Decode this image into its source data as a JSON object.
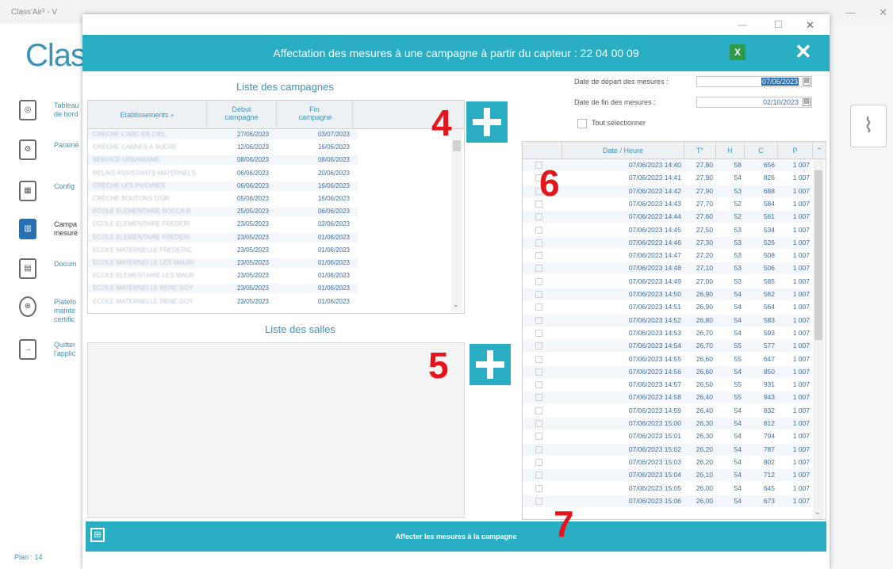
{
  "bg_window": {
    "title": "Class'Air² - V",
    "controls": [
      "—",
      "☐",
      "✕"
    ],
    "logo": "Class",
    "sidebar": [
      {
        "icon": "dashboard-icon",
        "label": "Tableau de bord"
      },
      {
        "icon": "settings-icon",
        "label": "Paramè"
      },
      {
        "icon": "building-icon",
        "label": "Config"
      },
      {
        "icon": "campaign-icon",
        "label": "Campa mesure"
      },
      {
        "icon": "document-icon",
        "label": "Docum"
      },
      {
        "icon": "globe-icon",
        "label": "Platefo mainte certific"
      },
      {
        "icon": "exit-icon",
        "label": "Quitter l'applic"
      }
    ],
    "plan": "Plan : 14"
  },
  "modal": {
    "controls": [
      "—",
      "☐",
      "✕"
    ],
    "title": "Affectation des mesures à une campagne à partir du capteur : 22 04 00 09",
    "close": "✕",
    "excel_label": "X"
  },
  "campaigns": {
    "title": "Liste des campagnes",
    "headers": [
      "Etablissements",
      "Début campagne",
      "Fin campagne"
    ],
    "rows": [
      {
        "name": "CRECHE L'ARC EN CIEL",
        "start": "27/06/2023",
        "end": "03/07/2023"
      },
      {
        "name": "CRECHE CANNES A SUCRE",
        "start": "12/06/2023",
        "end": "16/06/2023"
      },
      {
        "name": "SERVICE URBANISME",
        "start": "08/06/2023",
        "end": "08/06/2023"
      },
      {
        "name": "RELAIS ASSISTANTS MATERNELS",
        "start": "06/06/2023",
        "end": "20/06/2023"
      },
      {
        "name": "CRECHE LES PIVOINES",
        "start": "06/06/2023",
        "end": "16/06/2023"
      },
      {
        "name": "CRECHE BOUTONS D'OR",
        "start": "05/06/2023",
        "end": "16/06/2023"
      },
      {
        "name": "ECOLE ELEMENTAIRE BOCCA R",
        "start": "25/05/2023",
        "end": "06/06/2023"
      },
      {
        "name": "ECOLE ELEMENTAIRE FREDERI",
        "start": "23/05/2023",
        "end": "02/06/2023"
      },
      {
        "name": "ECOLE ELEMENTAIRE FREDERI",
        "start": "23/05/2023",
        "end": "01/06/2023"
      },
      {
        "name": "ECOLE MATERNELLE FREDERIC",
        "start": "23/05/2023",
        "end": "01/06/2023"
      },
      {
        "name": "ECOLE MATERNELLE LES MAURI",
        "start": "23/05/2023",
        "end": "01/06/2023"
      },
      {
        "name": "ECOLE ELEMENTAIRE LES MAUR",
        "start": "23/05/2023",
        "end": "01/06/2023"
      },
      {
        "name": "ECOLE MATERNELLE RENE GOY",
        "start": "23/05/2023",
        "end": "01/06/2023"
      },
      {
        "name": "ECOLE MATERNELLE RENE GOY",
        "start": "23/05/2023",
        "end": "01/06/2023"
      }
    ]
  },
  "rooms": {
    "title": "Liste des salles"
  },
  "markers": {
    "n4": "4",
    "n5": "5",
    "n6": "6",
    "n7": "7"
  },
  "measures": {
    "start_label": "Date de départ des mesures :",
    "start_value": "07/06/2023",
    "end_label": "Date de fin des mesures :",
    "end_value": "02/10/2023",
    "select_all": "Tout sélectionner",
    "headers": [
      "Date / Heure",
      "T°",
      "H",
      "C",
      "P"
    ],
    "rows": [
      [
        "07/06/2023 14:40",
        "27,80",
        "58",
        "656",
        "1 007"
      ],
      [
        "07/06/2023 14:41",
        "27,90",
        "54",
        "826",
        "1 007"
      ],
      [
        "07/06/2023 14:42",
        "27,90",
        "53",
        "688",
        "1 007"
      ],
      [
        "07/06/2023 14:43",
        "27,70",
        "52",
        "584",
        "1 007"
      ],
      [
        "07/06/2023 14:44",
        "27,60",
        "52",
        "561",
        "1 007"
      ],
      [
        "07/06/2023 14:45",
        "27,50",
        "53",
        "534",
        "1 007"
      ],
      [
        "07/06/2023 14:46",
        "27,30",
        "53",
        "526",
        "1 007"
      ],
      [
        "07/06/2023 14:47",
        "27,20",
        "53",
        "508",
        "1 007"
      ],
      [
        "07/06/2023 14:48",
        "27,10",
        "53",
        "506",
        "1 007"
      ],
      [
        "07/06/2023 14:49",
        "27,00",
        "53",
        "585",
        "1 007"
      ],
      [
        "07/06/2023 14:50",
        "26,90",
        "54",
        "562",
        "1 007"
      ],
      [
        "07/06/2023 14:51",
        "26,90",
        "54",
        "564",
        "1 007"
      ],
      [
        "07/06/2023 14:52",
        "26,80",
        "54",
        "583",
        "1 007"
      ],
      [
        "07/06/2023 14:53",
        "26,70",
        "54",
        "593",
        "1 007"
      ],
      [
        "07/06/2023 14:54",
        "26,70",
        "55",
        "577",
        "1 007"
      ],
      [
        "07/06/2023 14:55",
        "26,60",
        "55",
        "647",
        "1 007"
      ],
      [
        "07/06/2023 14:56",
        "26,60",
        "54",
        "850",
        "1 007"
      ],
      [
        "07/06/2023 14:57",
        "26,50",
        "55",
        "931",
        "1 007"
      ],
      [
        "07/06/2023 14:58",
        "26,40",
        "55",
        "943",
        "1 007"
      ],
      [
        "07/06/2023 14:59",
        "26,40",
        "54",
        "832",
        "1 007"
      ],
      [
        "07/06/2023 15:00",
        "26,30",
        "54",
        "812",
        "1 007"
      ],
      [
        "07/06/2023 15:01",
        "26,30",
        "54",
        "794",
        "1 007"
      ],
      [
        "07/06/2023 15:02",
        "26,20",
        "54",
        "787",
        "1 007"
      ],
      [
        "07/06/2023 15:03",
        "26,20",
        "54",
        "802",
        "1 007"
      ],
      [
        "07/06/2023 15:04",
        "26,10",
        "54",
        "712",
        "1 007"
      ],
      [
        "07/06/2023 15:05",
        "26,00",
        "54",
        "645",
        "1 007"
      ],
      [
        "07/06/2023 15:06",
        "26,00",
        "54",
        "673",
        "1 007"
      ]
    ]
  },
  "footer": {
    "button_label": "Affecter les mesures à la campagne"
  }
}
